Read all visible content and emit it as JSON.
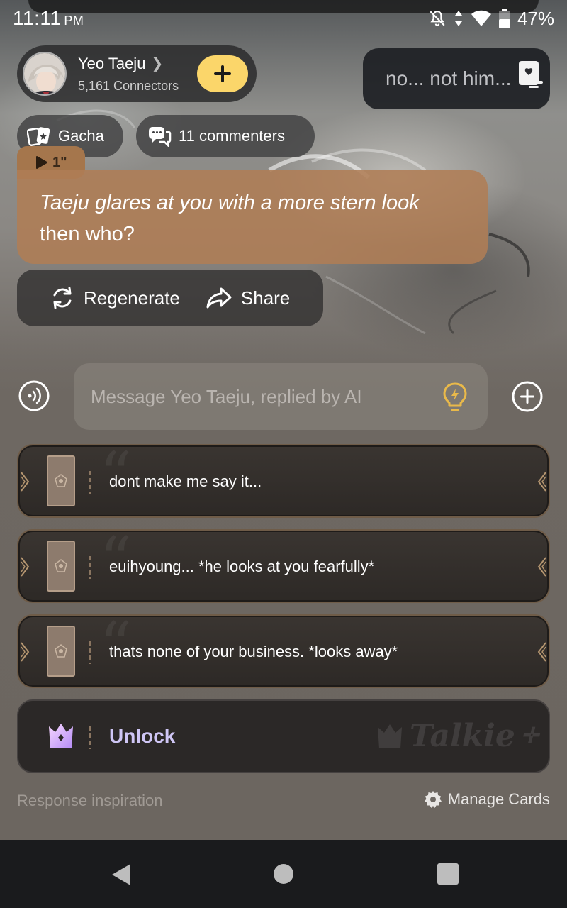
{
  "status_bar": {
    "time": "11:11",
    "ampm": "PM",
    "battery": "47%"
  },
  "character": {
    "name": "Yeo Taeju",
    "connectors": "5,161 Connectors"
  },
  "whisper": {
    "text": "no... not him..."
  },
  "chips": {
    "gacha": "Gacha",
    "commenters": "11 commenters"
  },
  "message": {
    "audio_length": "1\"",
    "action_text": "Taeju glares at you with a more stern look",
    "speech_text": "then who?"
  },
  "actions": {
    "regenerate": "Regenerate",
    "share": "Share"
  },
  "input": {
    "placeholder": "Message Yeo Taeju, replied by AI"
  },
  "cards": [
    {
      "text": "dont make me say it..."
    },
    {
      "text": "euihyoung... *he looks at you fearfully*"
    },
    {
      "text": "thats none of your business. *looks away*"
    }
  ],
  "unlock": {
    "label": "Unlock",
    "watermark": "Talkie"
  },
  "footer": {
    "response_inspiration": "Response inspiration",
    "manage_cards": "Manage Cards"
  },
  "colors": {
    "accent_yellow": "#fbd66a",
    "message_bubble": "#af7d55",
    "unlock_text": "#cfc6f5",
    "bulb": "#e9b94a"
  },
  "icons": {
    "status": [
      "bell-off-icon",
      "data-arrows-icon",
      "wifi-icon",
      "battery-icon"
    ],
    "nav": [
      "back-icon",
      "home-icon",
      "recents-icon"
    ]
  }
}
